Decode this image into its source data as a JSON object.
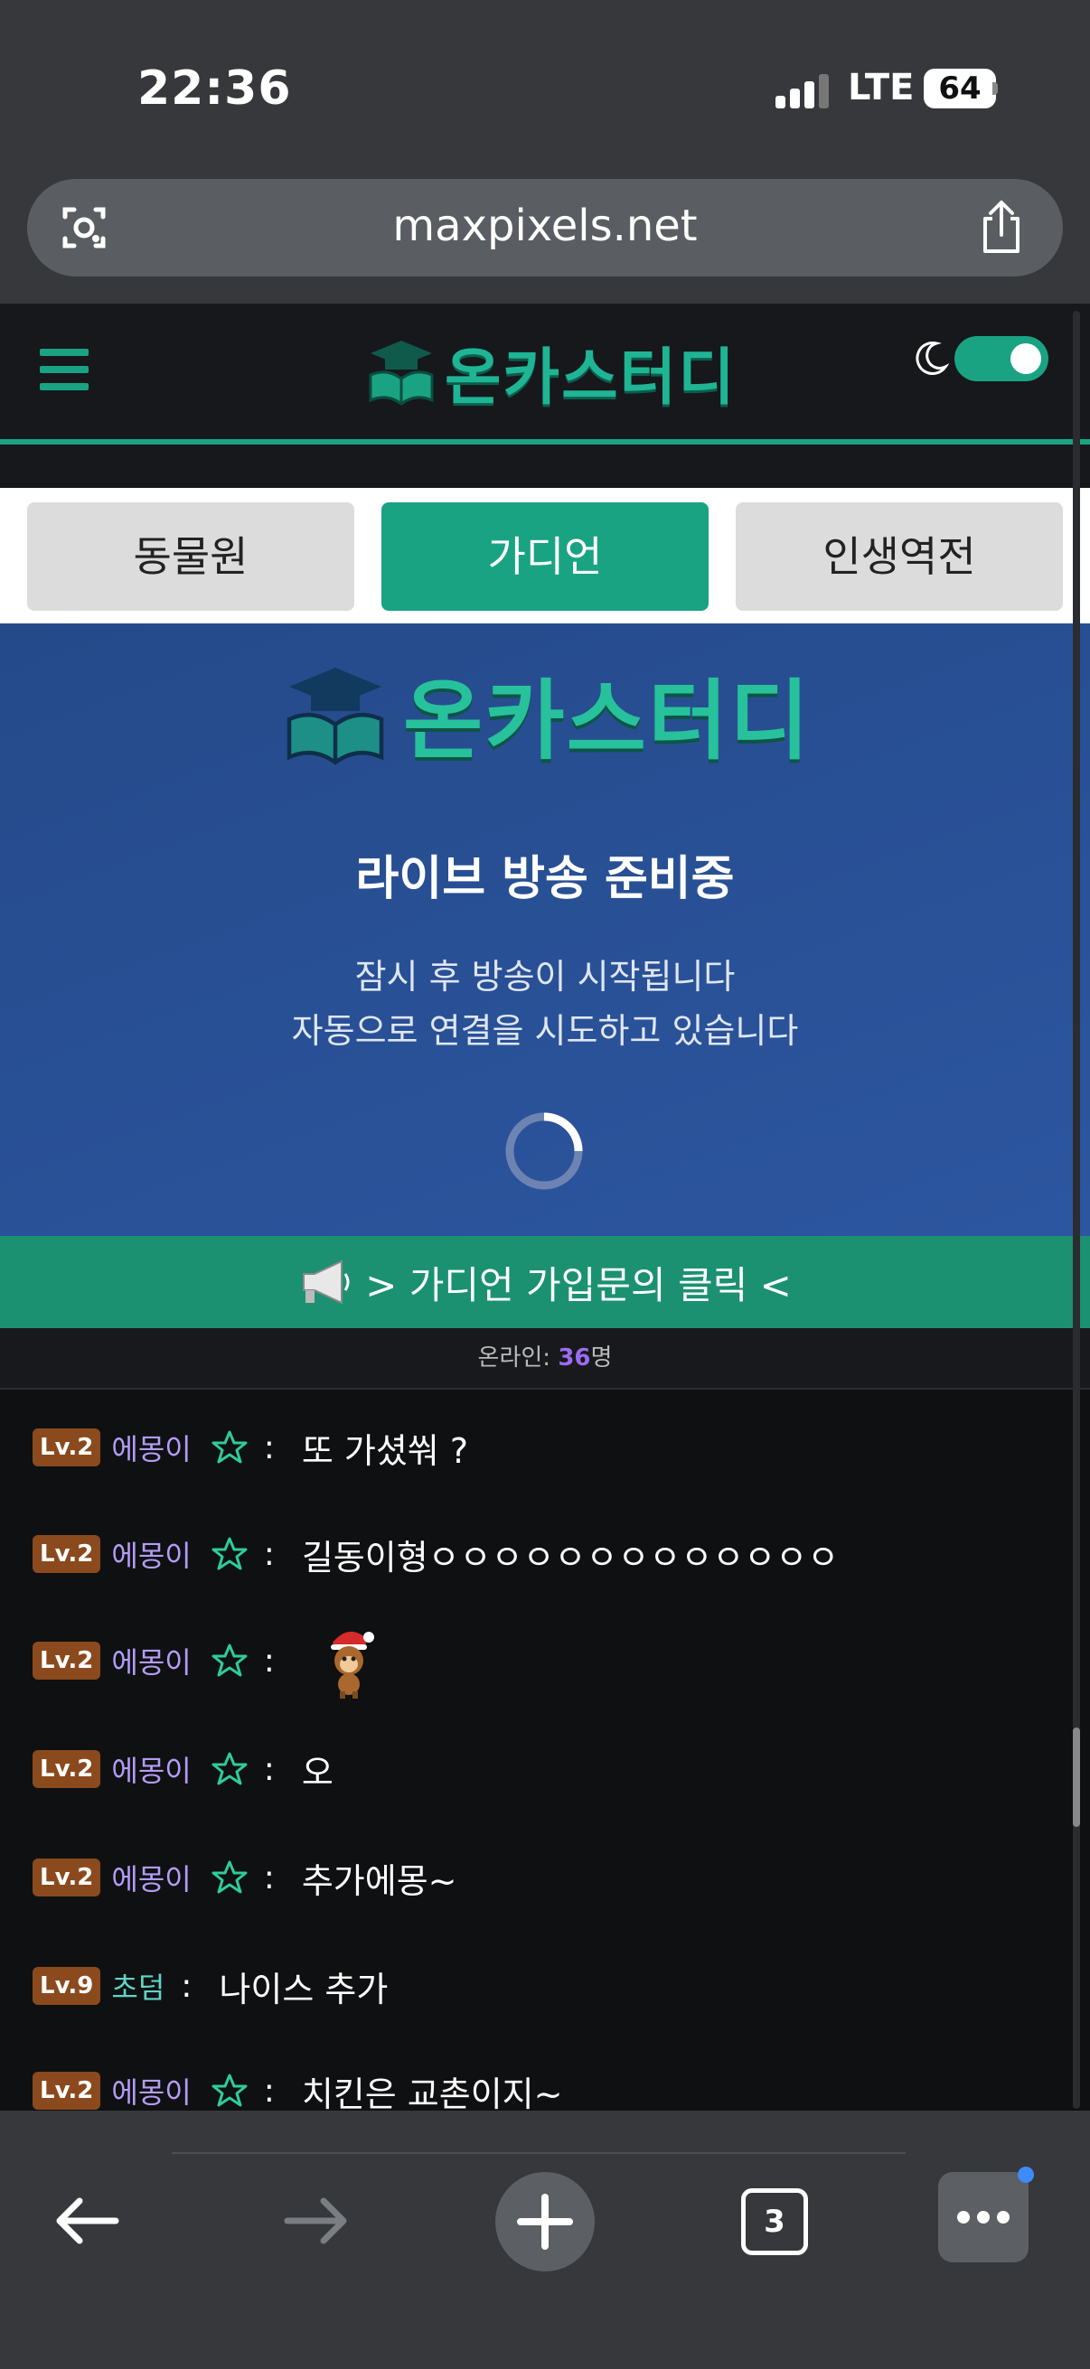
{
  "status": {
    "time": "22:36",
    "network": "LTE",
    "battery": "64"
  },
  "browser": {
    "url": "maxpixels.net",
    "tab_count": "3"
  },
  "site": {
    "logo": "온카스터디"
  },
  "tabs": [
    {
      "label": "동물원"
    },
    {
      "label": "가디언",
      "active": true
    },
    {
      "label": "인생역전"
    }
  ],
  "hero": {
    "title": "라이브 방송 준비중",
    "line1": "잠시 후 방송이 시작됩니다",
    "line2": "자동으로 연결을 시도하고 있습니다"
  },
  "cta": {
    "text": "> 가디언 가입문의 클릭 <"
  },
  "online": {
    "label": "온라인:",
    "count": "36",
    "unit": "명"
  },
  "chat": [
    {
      "level": "Lv.2",
      "nick": "에몽이",
      "text": "또 가셨쒀 ?"
    },
    {
      "level": "Lv.2",
      "nick": "에몽이",
      "text": "길동이형ㅇㅇㅇㅇㅇㅇㅇㅇㅇㅇㅇㅇㅇ"
    },
    {
      "level": "Lv.2",
      "nick": "에몽이",
      "text": ""
    },
    {
      "level": "Lv.2",
      "nick": "에몽이",
      "text": "오"
    },
    {
      "level": "Lv.2",
      "nick": "에몽이",
      "text": "추가에몽~"
    },
    {
      "level": "Lv.9",
      "nick": "초덤",
      "text": "나이스 추가"
    },
    {
      "level": "Lv.2",
      "nick": "에몽이",
      "text": "치킨은 교촌이지~"
    }
  ],
  "colors": {
    "accent": "#1aa383",
    "nick_purple": "#b49cf5",
    "nick_teal": "#5fd6c6",
    "level_badge": "#8b4a1d"
  }
}
